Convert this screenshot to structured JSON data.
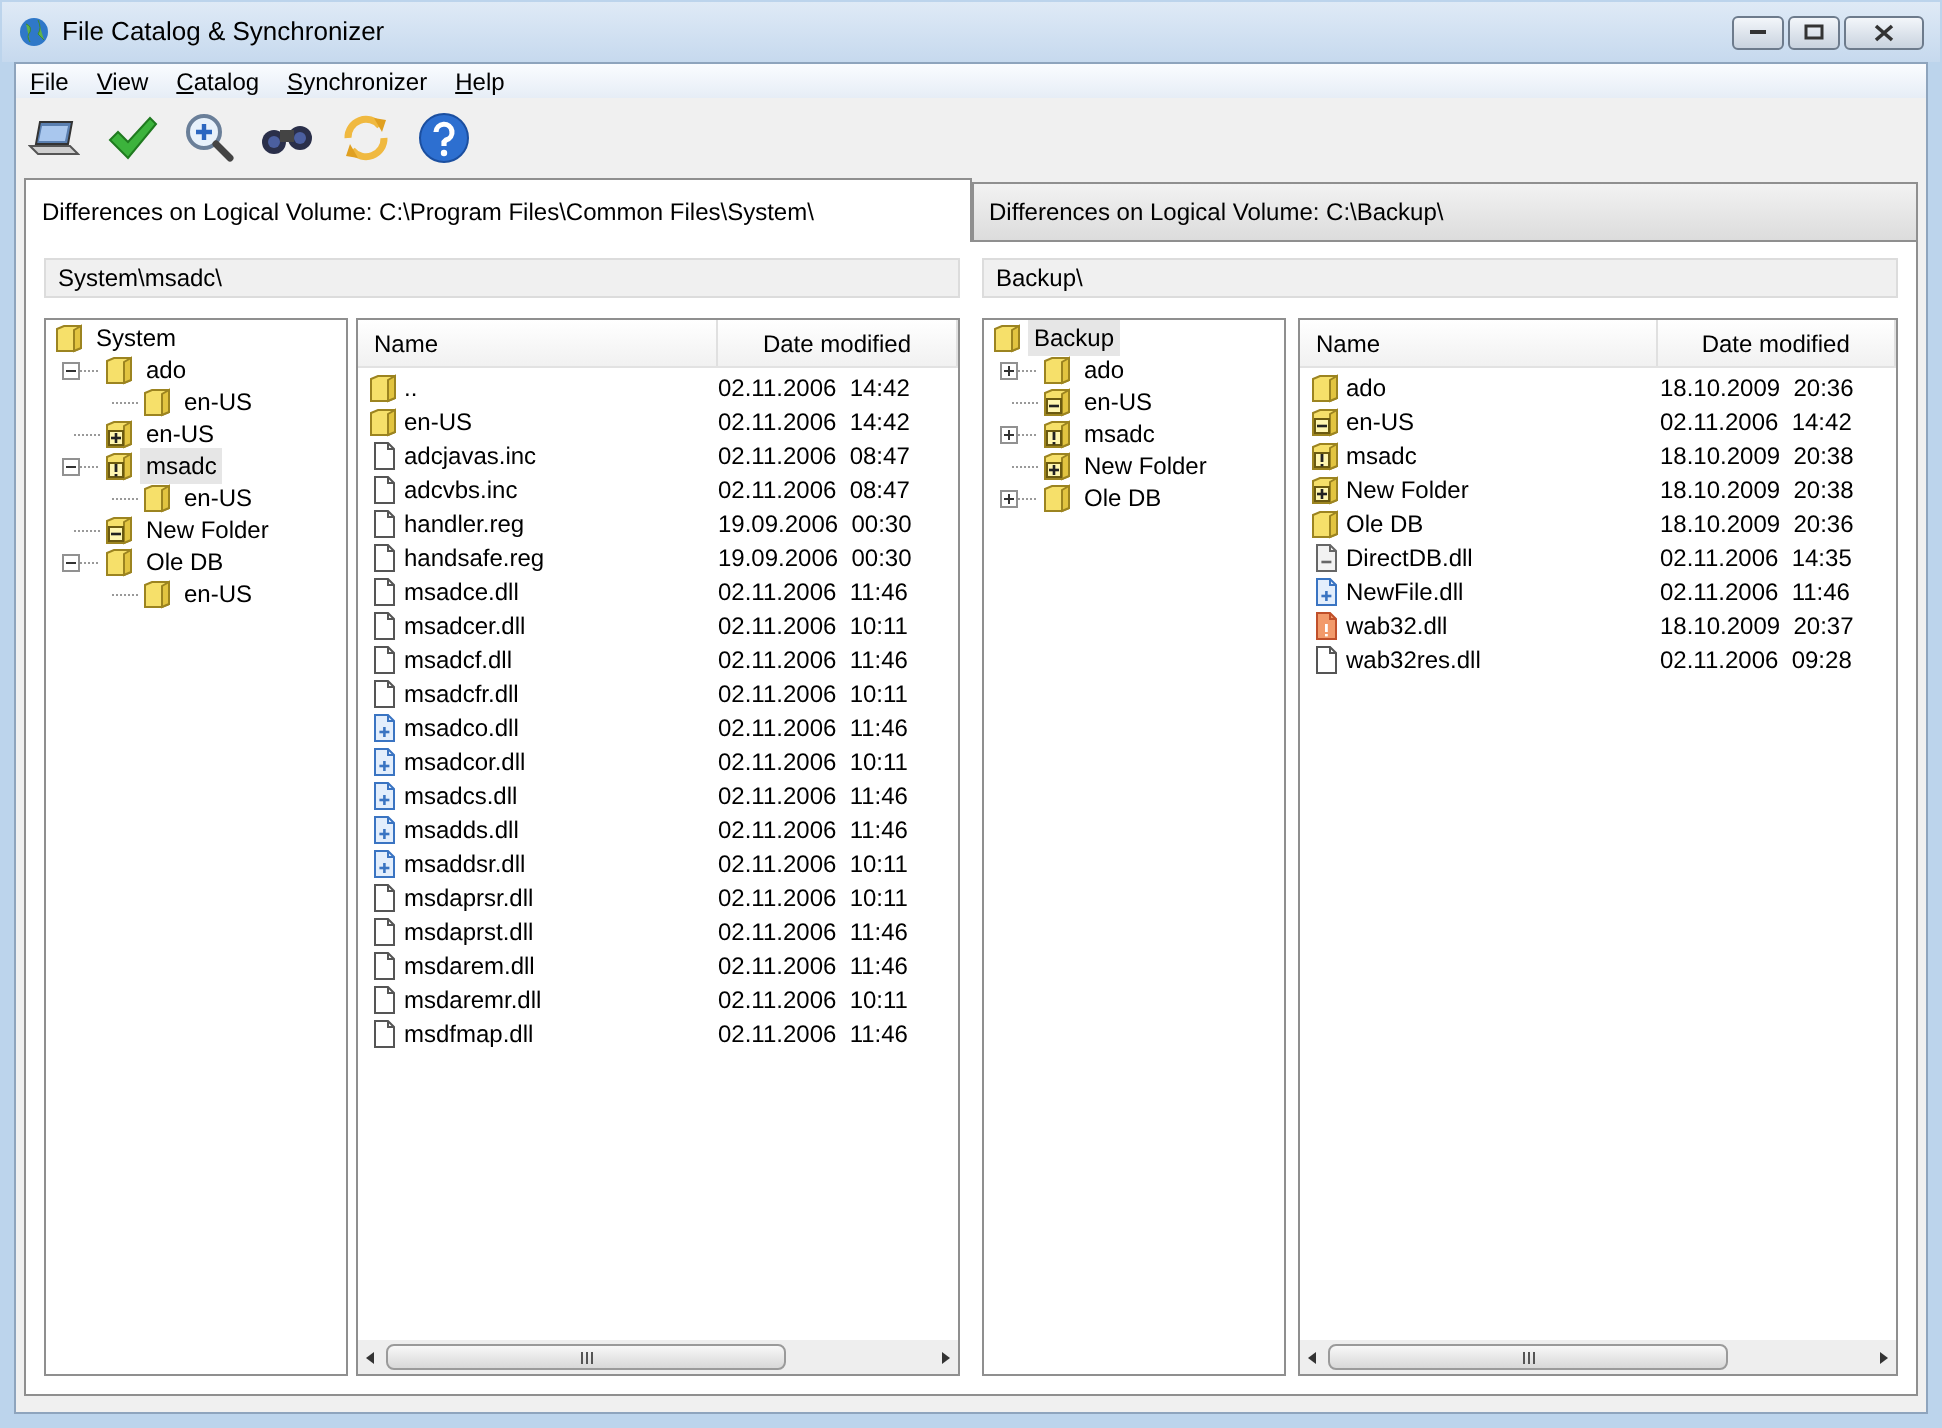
{
  "window": {
    "title": "File Catalog & Synchronizer"
  },
  "menu": [
    {
      "label": "File"
    },
    {
      "label": "View"
    },
    {
      "label": "Catalog"
    },
    {
      "label": "Synchronizer"
    },
    {
      "label": "Help"
    }
  ],
  "toolbar": [
    {
      "kind": "laptop"
    },
    {
      "kind": "check"
    },
    {
      "kind": "zoom"
    },
    {
      "kind": "binoculars"
    },
    {
      "kind": "sync"
    },
    {
      "kind": "help"
    }
  ],
  "tabs": [
    {
      "label": "Differences on Logical Volume: C:\\Program Files\\Common Files\\System\\",
      "selected": true,
      "path": "System\\msadc\\",
      "tree": {
        "label": "System",
        "added": false,
        "removed": false,
        "changed": false,
        "selected": false,
        "children": [
          {
            "label": "ado",
            "added": false,
            "removed": false,
            "changed": false,
            "selected": false,
            "expanded": true,
            "children": [
              {
                "label": "en-US",
                "added": false,
                "removed": false,
                "changed": false,
                "selected": false
              }
            ]
          },
          {
            "label": "en-US",
            "added": true,
            "removed": false,
            "changed": false,
            "selected": false
          },
          {
            "label": "msadc",
            "added": false,
            "removed": false,
            "changed": true,
            "selected": true,
            "expanded": true,
            "children": [
              {
                "label": "en-US",
                "added": false,
                "removed": false,
                "changed": false,
                "selected": false
              }
            ]
          },
          {
            "label": "New Folder",
            "added": false,
            "removed": true,
            "changed": false,
            "selected": false
          },
          {
            "label": "Ole DB",
            "added": false,
            "removed": false,
            "changed": false,
            "selected": false,
            "expanded": true,
            "children": [
              {
                "label": "en-US",
                "added": false,
                "removed": false,
                "changed": false,
                "selected": false
              }
            ]
          }
        ]
      },
      "columns": [
        "Name",
        "Date modified"
      ],
      "rows": [
        {
          "name": "..",
          "kind": "folder",
          "added": false,
          "removed": false,
          "changed": false,
          "date": "02.11.2006  14:42"
        },
        {
          "name": "en-US",
          "kind": "folder",
          "added": false,
          "removed": false,
          "changed": false,
          "date": "02.11.2006  14:42"
        },
        {
          "name": "adcjavas.inc",
          "kind": "file",
          "added": false,
          "removed": false,
          "changed": false,
          "date": "02.11.2006  08:47"
        },
        {
          "name": "adcvbs.inc",
          "kind": "file",
          "added": false,
          "removed": false,
          "changed": false,
          "date": "02.11.2006  08:47"
        },
        {
          "name": "handler.reg",
          "kind": "file",
          "added": false,
          "removed": false,
          "changed": false,
          "date": "19.09.2006  00:30"
        },
        {
          "name": "handsafe.reg",
          "kind": "file",
          "added": false,
          "removed": false,
          "changed": false,
          "date": "19.09.2006  00:30"
        },
        {
          "name": "msadce.dll",
          "kind": "file",
          "added": false,
          "removed": false,
          "changed": false,
          "date": "02.11.2006  11:46"
        },
        {
          "name": "msadcer.dll",
          "kind": "file",
          "added": false,
          "removed": false,
          "changed": false,
          "date": "02.11.2006  10:11"
        },
        {
          "name": "msadcf.dll",
          "kind": "file",
          "added": false,
          "removed": false,
          "changed": false,
          "date": "02.11.2006  11:46"
        },
        {
          "name": "msadcfr.dll",
          "kind": "file",
          "added": false,
          "removed": false,
          "changed": false,
          "date": "02.11.2006  10:11"
        },
        {
          "name": "msadco.dll",
          "kind": "file",
          "added": true,
          "removed": false,
          "changed": false,
          "date": "02.11.2006  11:46"
        },
        {
          "name": "msadcor.dll",
          "kind": "file",
          "added": true,
          "removed": false,
          "changed": false,
          "date": "02.11.2006  10:11"
        },
        {
          "name": "msadcs.dll",
          "kind": "file",
          "added": true,
          "removed": false,
          "changed": false,
          "date": "02.11.2006  11:46"
        },
        {
          "name": "msadds.dll",
          "kind": "file",
          "added": true,
          "removed": false,
          "changed": false,
          "date": "02.11.2006  11:46"
        },
        {
          "name": "msaddsr.dll",
          "kind": "file",
          "added": true,
          "removed": false,
          "changed": false,
          "date": "02.11.2006  10:11"
        },
        {
          "name": "msdaprsr.dll",
          "kind": "file",
          "added": false,
          "removed": false,
          "changed": false,
          "date": "02.11.2006  10:11"
        },
        {
          "name": "msdaprst.dll",
          "kind": "file",
          "added": false,
          "removed": false,
          "changed": false,
          "date": "02.11.2006  11:46"
        },
        {
          "name": "msdarem.dll",
          "kind": "file",
          "added": false,
          "removed": false,
          "changed": false,
          "date": "02.11.2006  11:46"
        },
        {
          "name": "msdaremr.dll",
          "kind": "file",
          "added": false,
          "removed": false,
          "changed": false,
          "date": "02.11.2006  10:11"
        },
        {
          "name": "msdfmap.dll",
          "kind": "file",
          "added": false,
          "removed": false,
          "changed": false,
          "date": "02.11.2006  11:46"
        }
      ]
    },
    {
      "label": "Differences on Logical Volume: C:\\Backup\\",
      "selected": false,
      "path": "Backup\\",
      "tree": {
        "label": "Backup",
        "added": false,
        "removed": false,
        "changed": false,
        "selected": true,
        "children": [
          {
            "label": "ado",
            "added": false,
            "removed": false,
            "changed": false,
            "selected": false,
            "expanded": false
          },
          {
            "label": "en-US",
            "added": false,
            "removed": true,
            "changed": false,
            "selected": false
          },
          {
            "label": "msadc",
            "added": false,
            "removed": false,
            "changed": true,
            "selected": false,
            "expanded": false
          },
          {
            "label": "New Folder",
            "added": true,
            "removed": false,
            "changed": false,
            "selected": false
          },
          {
            "label": "Ole DB",
            "added": false,
            "removed": false,
            "changed": false,
            "selected": false,
            "expanded": false
          }
        ]
      },
      "columns": [
        "Name",
        "Date modified"
      ],
      "rows": [
        {
          "name": "ado",
          "kind": "folder",
          "added": false,
          "removed": false,
          "changed": false,
          "date": "18.10.2009  20:36"
        },
        {
          "name": "en-US",
          "kind": "folder",
          "added": false,
          "removed": true,
          "changed": false,
          "date": "02.11.2006  14:42"
        },
        {
          "name": "msadc",
          "kind": "folder",
          "added": false,
          "removed": false,
          "changed": true,
          "date": "18.10.2009  20:38"
        },
        {
          "name": "New Folder",
          "kind": "folder",
          "added": true,
          "removed": false,
          "changed": false,
          "date": "18.10.2009  20:38"
        },
        {
          "name": "Ole DB",
          "kind": "folder",
          "added": false,
          "removed": false,
          "changed": false,
          "date": "18.10.2009  20:36"
        },
        {
          "name": "DirectDB.dll",
          "kind": "file",
          "added": false,
          "removed": true,
          "changed": false,
          "date": "02.11.2006  14:35"
        },
        {
          "name": "NewFile.dll",
          "kind": "file",
          "added": true,
          "removed": false,
          "changed": false,
          "date": "02.11.2006  11:46"
        },
        {
          "name": "wab32.dll",
          "kind": "file",
          "added": false,
          "removed": false,
          "changed": true,
          "date": "18.10.2009  20:37"
        },
        {
          "name": "wab32res.dll",
          "kind": "file",
          "added": false,
          "removed": false,
          "changed": false,
          "date": "02.11.2006  09:28"
        }
      ]
    }
  ]
}
